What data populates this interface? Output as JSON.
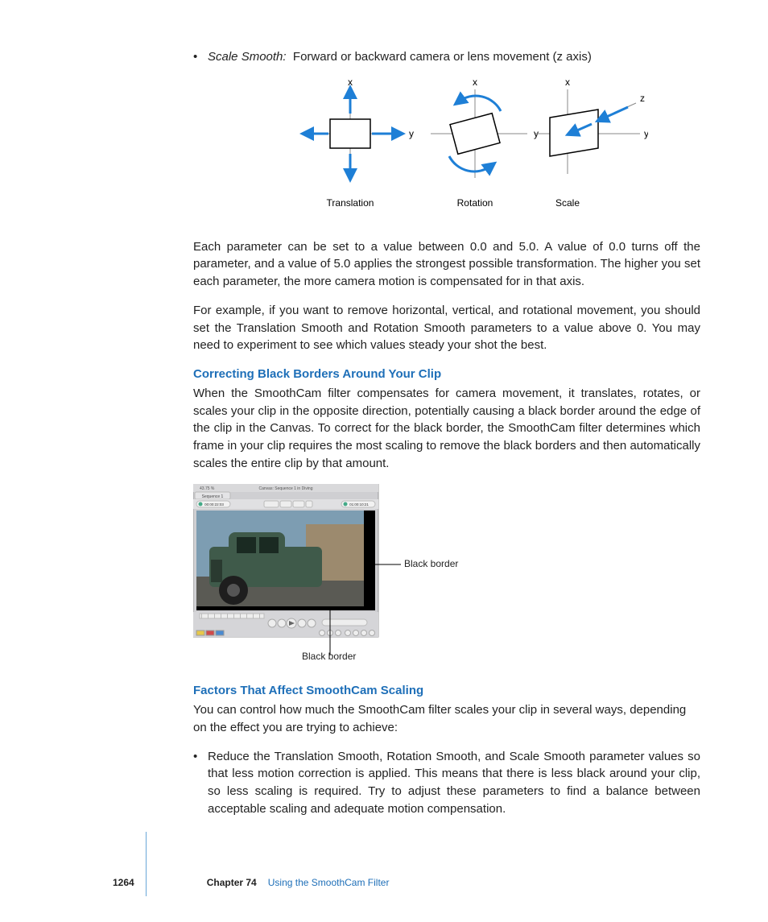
{
  "bullet1": {
    "term": "Scale Smooth:",
    "desc": "Forward or backward camera or lens movement (z axis)"
  },
  "diagram": {
    "x": "x",
    "y": "y",
    "z": "z",
    "cap1": "Translation",
    "cap2": "Rotation",
    "cap3": "Scale"
  },
  "p1": "Each parameter can be set to a value between 0.0 and 5.0. A value of 0.0 turns off the parameter, and a value of 5.0 applies the strongest possible transformation. The higher you set each parameter, the more camera motion is compensated for in that axis.",
  "p2": "For example, if you want to remove horizontal, vertical, and rotational movement, you should set the Translation Smooth and Rotation Smooth parameters to a value above 0. You may need to experiment to see which values steady your shot the best.",
  "h1": "Correcting Black Borders Around Your Clip",
  "p3": "When the SmoothCam filter compensates for camera movement, it translates, rotates, or scales your clip in the opposite direction, potentially causing a black border around the edge of the clip in the Canvas. To correct for the black border, the SmoothCam filter determines which frame in your clip requires the most scaling to remove the black borders and then automatically scales the entire clip by that amount.",
  "fig2": {
    "label_right": "Black border",
    "label_bottom": "Black border",
    "canvas_title": "Canvas: Sequence 1 in Diving",
    "tab": "Sequence 1",
    "tc_left": "00:00:22:03",
    "tc_right": "01:00:10:21",
    "pct": "43.75 %"
  },
  "h2": "Factors That Affect SmoothCam Scaling",
  "p4": "You can control how much the SmoothCam filter scales your clip in several ways, depending on the effect you are trying to achieve:",
  "bullet2": "Reduce the Translation Smooth, Rotation Smooth, and Scale Smooth parameter values so that less motion correction is applied. This means that there is less black around your clip, so less scaling is required. Try to adjust these parameters to find a balance between acceptable scaling and adequate motion compensation.",
  "footer": {
    "page": "1264",
    "chapter": "Chapter 74",
    "title": "Using the SmoothCam Filter"
  }
}
